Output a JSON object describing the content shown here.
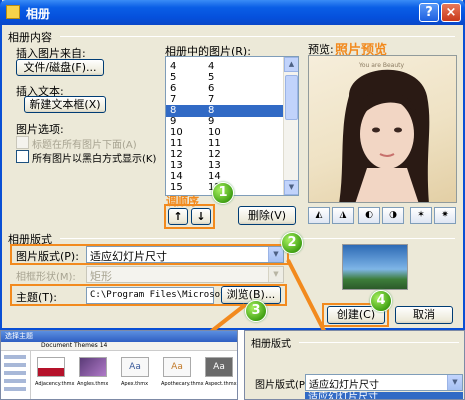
{
  "window": {
    "title": "相册",
    "help": "?",
    "close": "×"
  },
  "album_content": {
    "header": "相册内容",
    "insert_from": "插入图片来自:",
    "file_disk_button": "文件/磁盘(F)...",
    "insert_text": "插入文本:",
    "new_textbox_button": "新建文本框(X)",
    "picture_options": "图片选项:",
    "captions_below": "标题在所有图片下面(A)",
    "all_black_white": "所有图片以黑白方式显示(K)"
  },
  "pictures_list": {
    "label": "相册中的图片(R):",
    "rows": [
      {
        "a": "4",
        "b": "4"
      },
      {
        "a": "5",
        "b": "5"
      },
      {
        "a": "6",
        "b": "6"
      },
      {
        "a": "7",
        "b": "7"
      },
      {
        "a": "8",
        "b": "8"
      },
      {
        "a": "9",
        "b": "9"
      },
      {
        "a": "10",
        "b": "10"
      },
      {
        "a": "11",
        "b": "11"
      },
      {
        "a": "12",
        "b": "12"
      },
      {
        "a": "13",
        "b": "13"
      },
      {
        "a": "14",
        "b": "14"
      },
      {
        "a": "15",
        "b": "15"
      }
    ],
    "selected_row": 4,
    "adjust_order_label": "调顺序",
    "move_up": "↑",
    "move_down": "↓",
    "delete_button": "删除(V)"
  },
  "preview": {
    "label": "预览:",
    "annotation": "照片预览",
    "photo_caption": "You are Beauty"
  },
  "album_layout": {
    "header": "相册版式",
    "picture_layout_label": "图片版式(P):",
    "picture_layout_value": "适应幻灯片尺寸",
    "frame_shape_label": "相框形状(M):",
    "frame_shape_value": "矩形",
    "theme_label": "主题(T):",
    "theme_value": "C:\\Program Files\\Microsof",
    "browse_button": "浏览(B)..."
  },
  "footer": {
    "create_button": "创建(C)",
    "cancel_button": "取消"
  },
  "badges": [
    "1",
    "2",
    "3",
    "4"
  ],
  "bottom_left": {
    "title": "选择主题",
    "path": "Document Themes 14",
    "themes": [
      "Adjacency.thmx",
      "Angles.thmx",
      "Apex.thmx",
      "Apothecary.thmx",
      "Aspect.thmx"
    ]
  },
  "bottom_right": {
    "header": "相册版式",
    "picture_layout_label": "图片版式(P):",
    "picture_layout_value": "适应幻灯片尺寸",
    "highlight_value": "适应幻灯片尺寸"
  },
  "colors": {
    "titlebar": "#0a5ee6",
    "dialog_bg": "#ece9d8",
    "highlight": "#f28a1e",
    "selection": "#316ac5",
    "annotation": "#f28a1e",
    "badge": "#42a215"
  }
}
